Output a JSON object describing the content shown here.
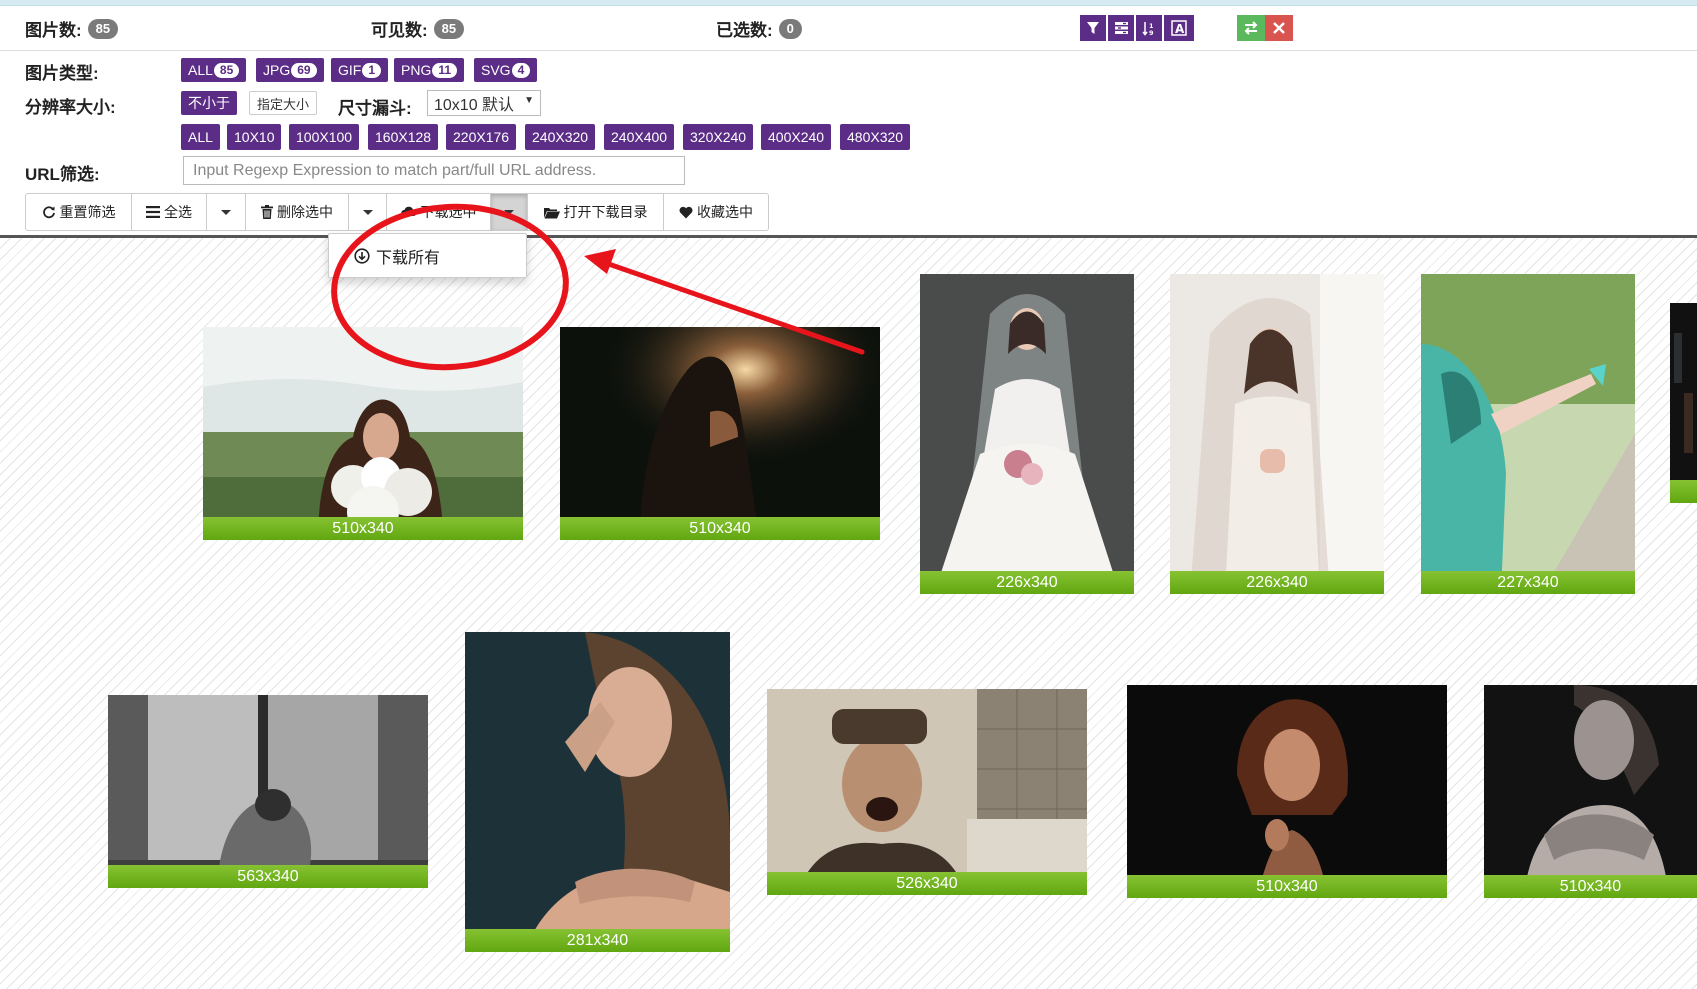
{
  "stats": {
    "total_label": "图片数:",
    "total": "85",
    "visible_label": "可见数:",
    "visible": "85",
    "selected_label": "已选数:",
    "selected": "0"
  },
  "toolbar_icons": [
    "filter-icon",
    "tasks-icon",
    "sort-icon",
    "font-icon",
    "exchange-icon",
    "close-icon"
  ],
  "filters": {
    "type_label": "图片类型:",
    "types": [
      {
        "name": "ALL",
        "count": "85"
      },
      {
        "name": "JPG",
        "count": "69"
      },
      {
        "name": "GIF",
        "count": "1"
      },
      {
        "name": "PNG",
        "count": "11"
      },
      {
        "name": "SVG",
        "count": "4"
      }
    ],
    "resolution_label": "分辨率大小:",
    "not_smaller": "不小于",
    "specified_size": "指定大小",
    "funnel_label": "尺寸漏斗:",
    "funnel_value": "10x10 默认",
    "sizes": [
      "ALL",
      "10X10",
      "100X100",
      "160X128",
      "220X176",
      "240X320",
      "240X400",
      "320X240",
      "400X240",
      "480X320"
    ],
    "url_label": "URL筛选:",
    "url_placeholder": "Input Regexp Expression to match part/full URL address."
  },
  "actions": {
    "reset": "重置筛选",
    "select_all": "全选",
    "delete_selected": "删除选中",
    "download_selected": "下载选中",
    "open_download_dir": "打开下载目录",
    "favorite_selected": "收藏选中"
  },
  "dropdown": {
    "download_all": "下载所有"
  },
  "images": [
    {
      "size": "510x340"
    },
    {
      "size": "510x340"
    },
    {
      "size": "226x340"
    },
    {
      "size": "226x340"
    },
    {
      "size": "227x340"
    },
    {
      "size": "563x340"
    },
    {
      "size": "281x340"
    },
    {
      "size": "526x340"
    },
    {
      "size": "510x340"
    },
    {
      "size": "510x340"
    }
  ],
  "colors": {
    "accent": "#5b2d86",
    "caption_green": "#6db31b",
    "annotation_red": "#e8141c",
    "success": "#5cb85c",
    "danger": "#d9534f"
  }
}
